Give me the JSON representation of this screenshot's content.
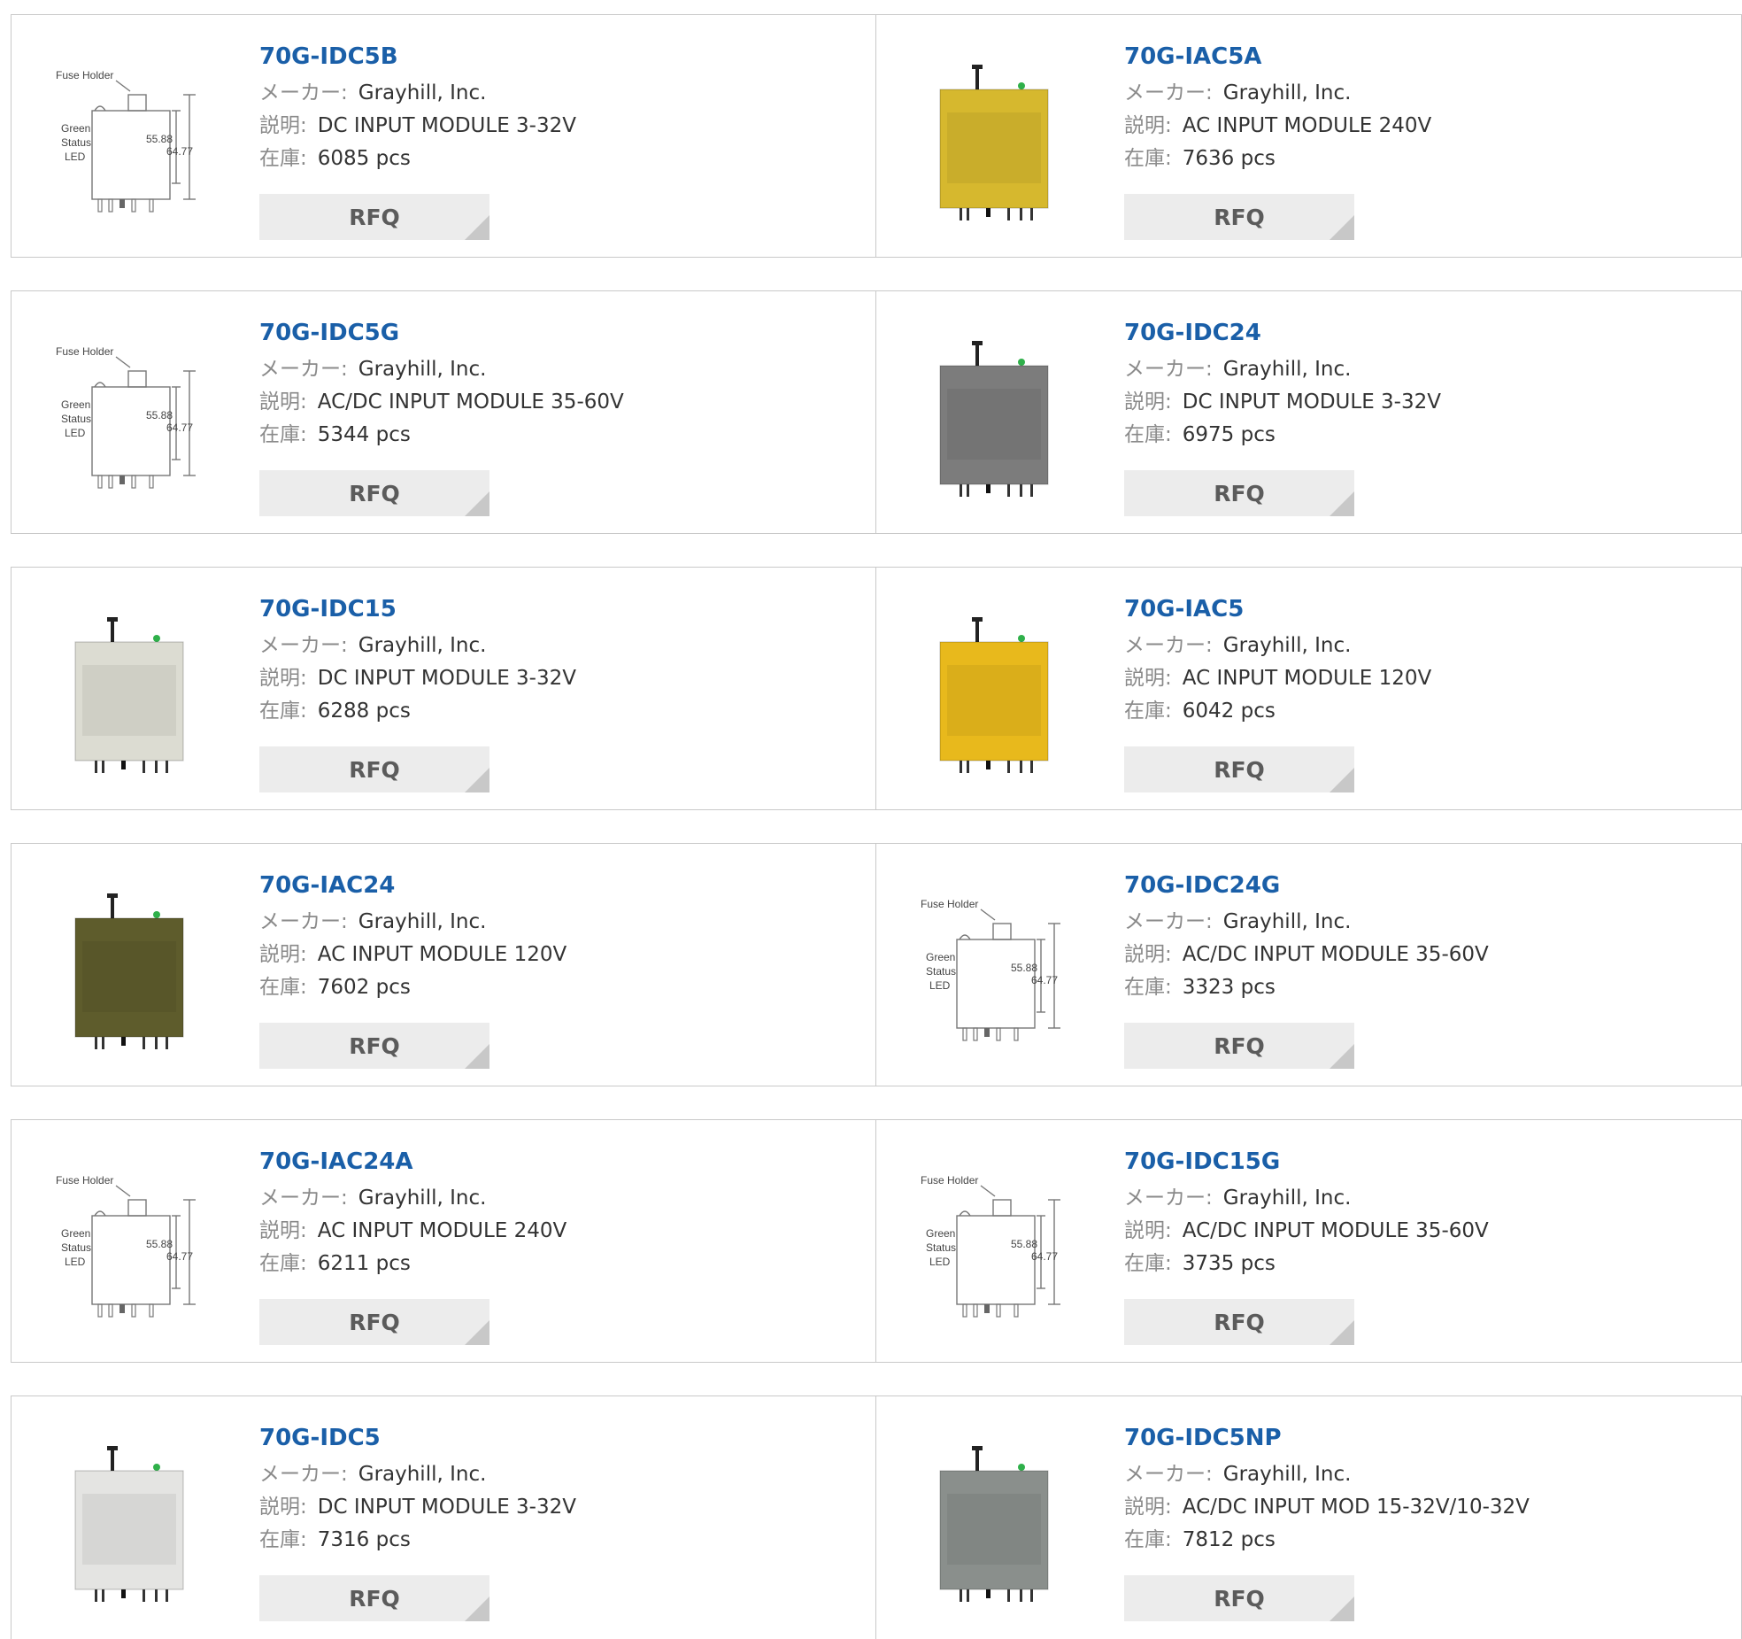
{
  "labels": {
    "maker": "メーカー:",
    "desc": "説明:",
    "stock": "在庫:",
    "rfq": "RFQ"
  },
  "diagram_text": {
    "fuse": "Fuse Holder",
    "green": "Green",
    "status": "Status",
    "led": "LED",
    "h1": "55.88",
    "h2": "64.77"
  },
  "products": [
    {
      "part": "70G-IDC5B",
      "maker": "Grayhill, Inc.",
      "desc": "DC INPUT MODULE 3-32V",
      "stock": "6085 pcs",
      "image": "diagram-icon",
      "color": "#ffffff"
    },
    {
      "part": "70G-IAC5A",
      "maker": "Grayhill, Inc.",
      "desc": "AC INPUT MODULE 240V",
      "stock": "7636 pcs",
      "image": "module-icon",
      "color": "#d6b82e"
    },
    {
      "part": "70G-IDC5G",
      "maker": "Grayhill, Inc.",
      "desc": "AC/DC INPUT MODULE 35-60V",
      "stock": "5344 pcs",
      "image": "diagram-icon",
      "color": "#ffffff"
    },
    {
      "part": "70G-IDC24",
      "maker": "Grayhill, Inc.",
      "desc": "DC INPUT MODULE 3-32V",
      "stock": "6975 pcs",
      "image": "module-icon",
      "color": "#7c7c7c"
    },
    {
      "part": "70G-IDC15",
      "maker": "Grayhill, Inc.",
      "desc": "DC INPUT MODULE 3-32V",
      "stock": "6288 pcs",
      "image": "module-icon",
      "color": "#dcdcd2"
    },
    {
      "part": "70G-IAC5",
      "maker": "Grayhill, Inc.",
      "desc": "AC INPUT MODULE 120V",
      "stock": "6042 pcs",
      "image": "module-icon",
      "color": "#e8b91c"
    },
    {
      "part": "70G-IAC24",
      "maker": "Grayhill, Inc.",
      "desc": "AC INPUT MODULE 120V",
      "stock": "7602 pcs",
      "image": "module-icon",
      "color": "#5e5c2c"
    },
    {
      "part": "70G-IDC24G",
      "maker": "Grayhill, Inc.",
      "desc": "AC/DC INPUT MODULE 35-60V",
      "stock": "3323 pcs",
      "image": "diagram-icon",
      "color": "#ffffff"
    },
    {
      "part": "70G-IAC24A",
      "maker": "Grayhill, Inc.",
      "desc": "AC INPUT MODULE 240V",
      "stock": "6211 pcs",
      "image": "diagram-icon",
      "color": "#ffffff"
    },
    {
      "part": "70G-IDC15G",
      "maker": "Grayhill, Inc.",
      "desc": "AC/DC INPUT MODULE 35-60V",
      "stock": "3735 pcs",
      "image": "diagram-icon",
      "color": "#ffffff"
    },
    {
      "part": "70G-IDC5",
      "maker": "Grayhill, Inc.",
      "desc": "DC INPUT MODULE 3-32V",
      "stock": "7316 pcs",
      "image": "module-icon",
      "color": "#e4e4e2"
    },
    {
      "part": "70G-IDC5NP",
      "maker": "Grayhill, Inc.",
      "desc": "AC/DC INPUT MOD 15-32V/10-32V",
      "stock": "7812 pcs",
      "image": "module-icon",
      "color": "#8a8f8c"
    }
  ]
}
